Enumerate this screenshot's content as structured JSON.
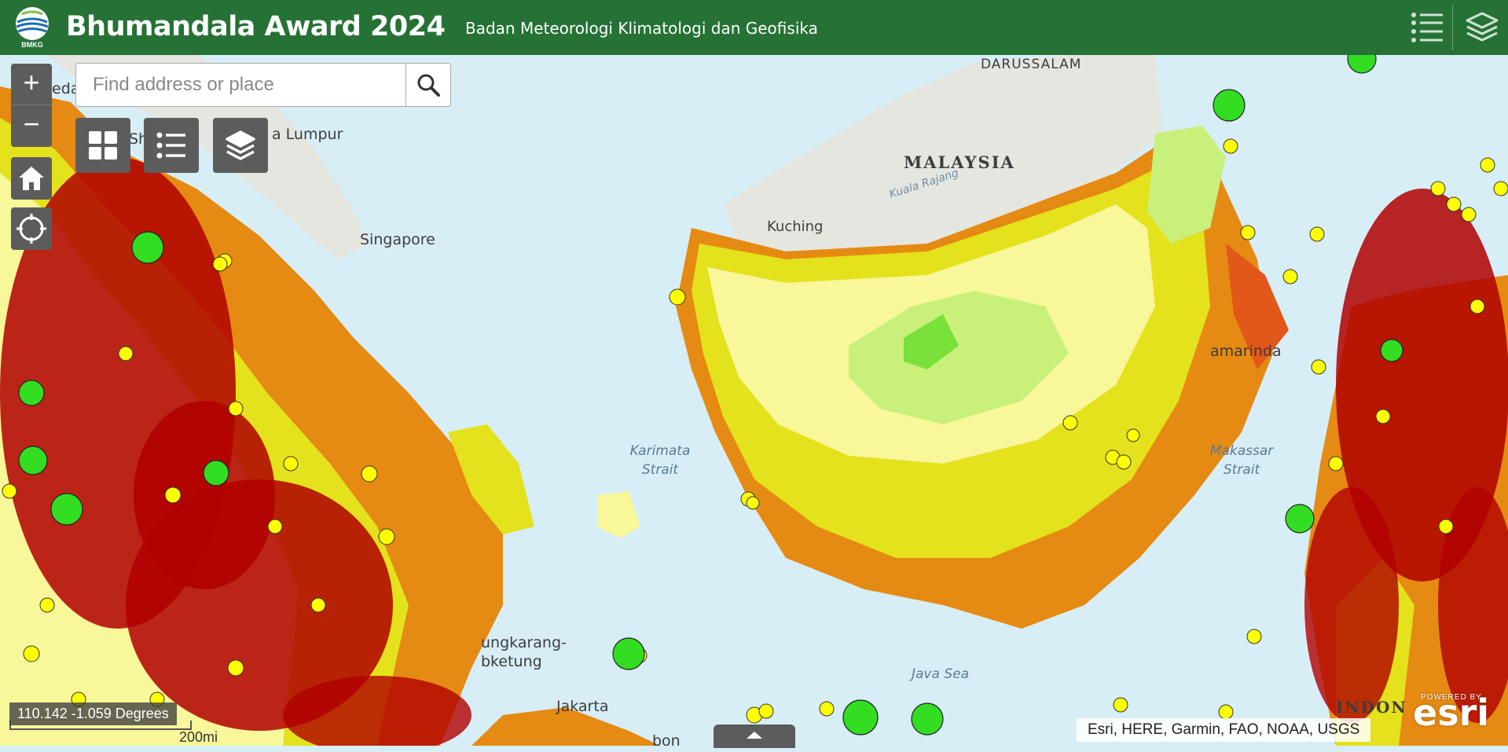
{
  "header": {
    "logo_text": "BMKG",
    "title": "Bhumandala Award 2024",
    "subtitle": "Badan Meteorologi Klimatologi dan Geofisika",
    "legend_icon": "legend-list-icon",
    "layers_icon": "layers-stack-icon"
  },
  "search": {
    "placeholder": "Find address or place",
    "value": ""
  },
  "controls": {
    "zoom_in": "+",
    "zoom_out": "−",
    "home_icon": "home-icon",
    "locate_icon": "locate-crosshair-icon",
    "basemap_icon": "basemap-grid-icon",
    "legend_icon": "legend-list-icon",
    "layers_icon": "layers-stack-icon"
  },
  "map_labels": {
    "darussalam": "DARUSSALAM",
    "malaysia": "MALAYSIA",
    "kuching": "Kuching",
    "kuala_rajang": "Kuala Rajang",
    "singapore": "Singapore",
    "kuala_lumpur": "a Lumpur",
    "left_edge_fragment": "eda",
    "left_fragment_sh": "Sh",
    "karimata_strait": "Karimata\nStrait",
    "makassar_strait": "Makassar\nStrait",
    "samarinda": "amarinda",
    "java_sea": "Java Sea",
    "tanjungkarang": "ungkarang-\nbketung",
    "jakarta": "Jakarta",
    "bottom_fragment": "bon",
    "indonesia_fragment": "INDON"
  },
  "scale": {
    "label": "200mi"
  },
  "coordinates": {
    "text": "110.142 -1.059 Degrees"
  },
  "attribution": "Esri, HERE, Garmin, FAO, NOAA, USGS",
  "esri_logo": {
    "powered_by": "POWERED BY",
    "brand": "esri"
  },
  "colors": {
    "header_green": "#267236",
    "sea": "#d7eef7",
    "land_grey": "#e6e6e0",
    "hazard_light_green": "#c8f07a",
    "hazard_bright_green": "#7ae03a",
    "hazard_pale_yellow": "#f8f79a",
    "hazard_yellow": "#e4e11d",
    "hazard_orange": "#e58a12",
    "hazard_red_orange": "#e2571a",
    "event_dot_red": "#c40000",
    "event_dot_yellow": "#ffff00",
    "event_dot_green": "#33dd22"
  }
}
